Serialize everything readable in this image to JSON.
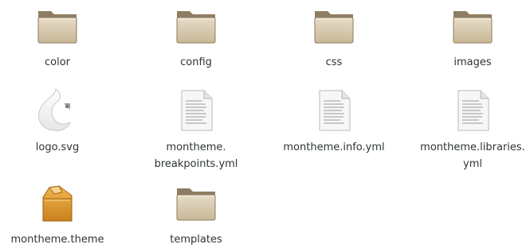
{
  "items": [
    {
      "line1": "color",
      "line2": "",
      "icon": "folder-icon"
    },
    {
      "line1": "config",
      "line2": "",
      "icon": "folder-icon"
    },
    {
      "line1": "css",
      "line2": "",
      "icon": "folder-icon"
    },
    {
      "line1": "images",
      "line2": "",
      "icon": "folder-icon"
    },
    {
      "line1": "logo.svg",
      "line2": "",
      "icon": "svg-image-icon"
    },
    {
      "line1": "montheme.",
      "line2": "breakpoints.yml",
      "icon": "text-file-icon"
    },
    {
      "line1": "montheme.info.yml",
      "line2": "",
      "icon": "text-file-icon"
    },
    {
      "line1": "montheme.libraries.",
      "line2": "yml",
      "icon": "text-file-icon"
    },
    {
      "line1": "montheme.theme",
      "line2": "",
      "icon": "package-icon"
    },
    {
      "line1": "templates",
      "line2": "",
      "icon": "folder-icon"
    }
  ],
  "colors": {
    "folder_body": "#d8c7aa",
    "folder_tab": "#8f7d63",
    "text": "#2e3436"
  }
}
